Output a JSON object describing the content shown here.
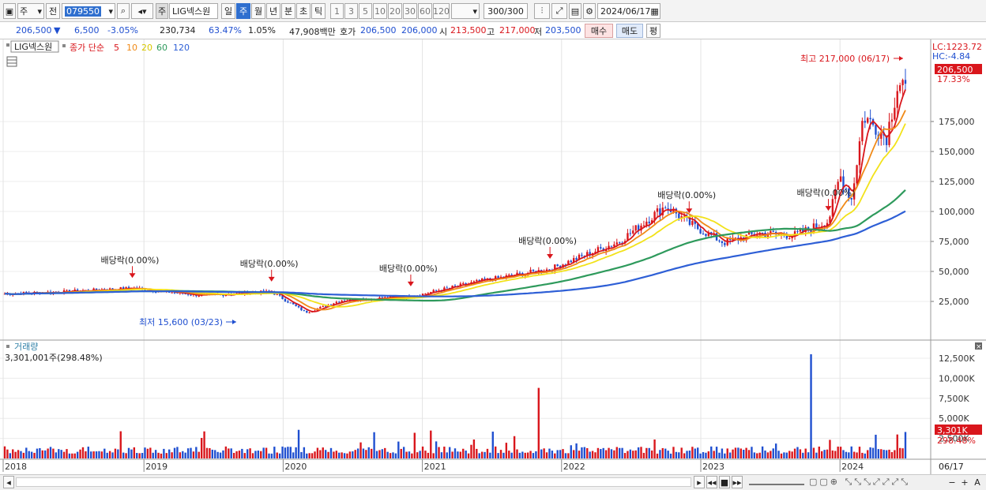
{
  "toolbar": {
    "market": "주",
    "prev": "전",
    "code": "079550",
    "stock_name": "LIG넥스원",
    "stock_tag": "주",
    "periods": [
      "일",
      "주",
      "월",
      "년",
      "분",
      "초",
      "틱"
    ],
    "selected_period": "주",
    "intervals": [
      "1",
      "3",
      "5",
      "10",
      "20",
      "30",
      "60",
      "120"
    ],
    "count": "300",
    "count_total": "/300",
    "date": "2024/06/17"
  },
  "quote": {
    "price": "206,500",
    "change": "6,500",
    "change_pct": "-3.05%",
    "volume": "230,734",
    "vol_ratio": "63.47%",
    "turnover": "1.05%",
    "amount": "47,908백만",
    "bid_label": "호가",
    "ask": "206,500",
    "bid": "206,000",
    "open_label": "시",
    "open": "213,500",
    "high_label": "고",
    "high": "217,000",
    "low_label": "저",
    "low": "203,500",
    "buy_label": "매수",
    "sell_label": "매도",
    "eval_label": "평"
  },
  "price_panel": {
    "title": "LIG넥스원",
    "ma_label": "종가 단순",
    "ma_periods": [
      "5",
      "10",
      "20",
      "60",
      "120"
    ],
    "ma_colors": [
      "#d9161c",
      "#f08a18",
      "#f2e21a",
      "#2e9a5c",
      "#2e5fd6"
    ],
    "lc_label": "LC:1223.72",
    "hc_label": "HC:-4.84",
    "last_price_tag": "206,500",
    "last_pct_tag": "17.33%",
    "high_annotation": "최고 217,000 (06/17)",
    "low_annotation": "최저 15,600 (03/23)",
    "y_ticks": [
      "175,000",
      "150,000",
      "125,000",
      "100,000",
      "75,000",
      "50,000",
      "25,000"
    ],
    "dividends": [
      {
        "label": "배당락(0.00%)",
        "date": "2018/12"
      },
      {
        "label": "배당락(0.00%)",
        "date": "2019/12"
      },
      {
        "label": "배당락(0.00%)",
        "date": "2020/12"
      },
      {
        "label": "배당락(0.00%)",
        "date": "2021/12"
      },
      {
        "label": "배당락(0.00%)",
        "date": "2022/12"
      },
      {
        "label": "배당락(0.00%)",
        "date": "2023/12"
      }
    ]
  },
  "volume_panel": {
    "title": "거래량",
    "current": "3,301,001주(298.48%)",
    "tag_value": "3,301K",
    "tag_pct": "298.48%",
    "y_ticks": [
      "12,500K",
      "10,000K",
      "7,500K",
      "5,000K",
      "2,500K"
    ]
  },
  "x_axis": {
    "labels": [
      "2018",
      "2019",
      "2020",
      "2021",
      "2022",
      "2023",
      "2024"
    ],
    "current_date": "06/17"
  },
  "chart_data": {
    "type": "line",
    "title": "LIG넥스원",
    "x": [
      "2018-06",
      "2018-12",
      "2019-06",
      "2019-12",
      "2020-03",
      "2020-06",
      "2020-12",
      "2021-06",
      "2021-12",
      "2022-06",
      "2022-10",
      "2022-12",
      "2023-03",
      "2023-06",
      "2023-09",
      "2023-12",
      "2024-01",
      "2024-02",
      "2024-03",
      "2024-05",
      "2024-06"
    ],
    "series": [
      {
        "name": "5",
        "values": [
          33000,
          36000,
          30000,
          33000,
          15600,
          26000,
          29000,
          42000,
          52000,
          75000,
          105000,
          90000,
          74000,
          82000,
          80000,
          92000,
          130000,
          110000,
          180000,
          162000,
          206500
        ]
      }
    ],
    "ylim": [
      0,
      225000
    ],
    "price_high": 217000,
    "price_low": 15600,
    "volume_max": 12500000,
    "volume_last": 3301001
  }
}
